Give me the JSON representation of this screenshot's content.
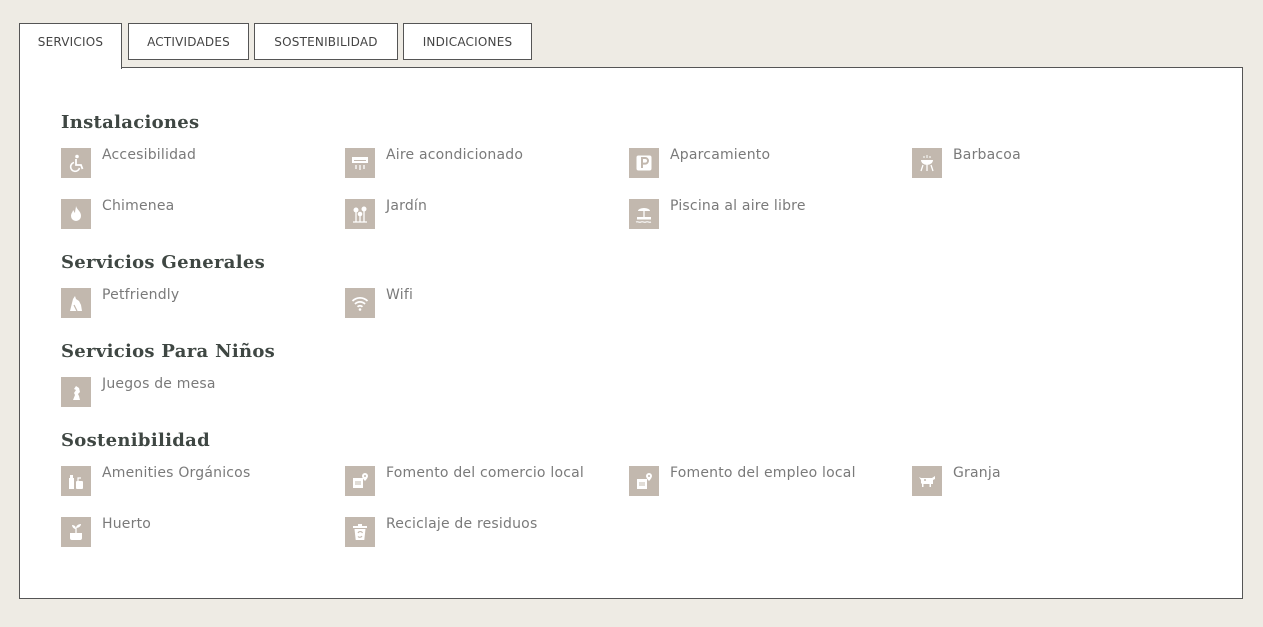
{
  "tabs": [
    {
      "label": "SERVICIOS",
      "active": true
    },
    {
      "label": "ACTIVIDADES",
      "active": false
    },
    {
      "label": "SOSTENIBILIDAD",
      "active": false
    },
    {
      "label": "INDICACIONES",
      "active": false
    }
  ],
  "sections": [
    {
      "title": "Instalaciones",
      "items": [
        {
          "label": "Accesibilidad",
          "icon": "wheelchair-icon"
        },
        {
          "label": "Aire acondicionado",
          "icon": "air-conditioner-icon"
        },
        {
          "label": "Aparcamiento",
          "icon": "parking-icon"
        },
        {
          "label": "Barbacoa",
          "icon": "barbecue-icon"
        },
        {
          "label": "Chimenea",
          "icon": "fire-icon"
        },
        {
          "label": "Jardín",
          "icon": "garden-icon"
        },
        {
          "label": "Piscina al aire libre",
          "icon": "outdoor-pool-icon"
        }
      ]
    },
    {
      "title": "Servicios Generales",
      "items": [
        {
          "label": "Petfriendly",
          "icon": "pet-icon"
        },
        {
          "label": "Wifi",
          "icon": "wifi-icon"
        }
      ]
    },
    {
      "title": "Servicios Para Niños",
      "items": [
        {
          "label": "Juegos de mesa",
          "icon": "chess-piece-icon"
        }
      ]
    },
    {
      "title": "Sostenibilidad",
      "items": [
        {
          "label": "Amenities Orgánicos",
          "icon": "organic-amenities-icon"
        },
        {
          "label": "Fomento del comercio local",
          "icon": "local-commerce-icon"
        },
        {
          "label": "Fomento del empleo local",
          "icon": "local-employment-icon"
        },
        {
          "label": "Granja",
          "icon": "cow-icon"
        },
        {
          "label": "Huerto",
          "icon": "vegetable-garden-icon"
        },
        {
          "label": "Reciclaje de residuos",
          "icon": "recycling-bin-icon"
        }
      ]
    }
  ],
  "colors": {
    "background": "#eeebe4",
    "icon_bg": "#c2b8ae",
    "heading": "#3f4743",
    "label": "#7a7a7a",
    "border": "#555555"
  }
}
